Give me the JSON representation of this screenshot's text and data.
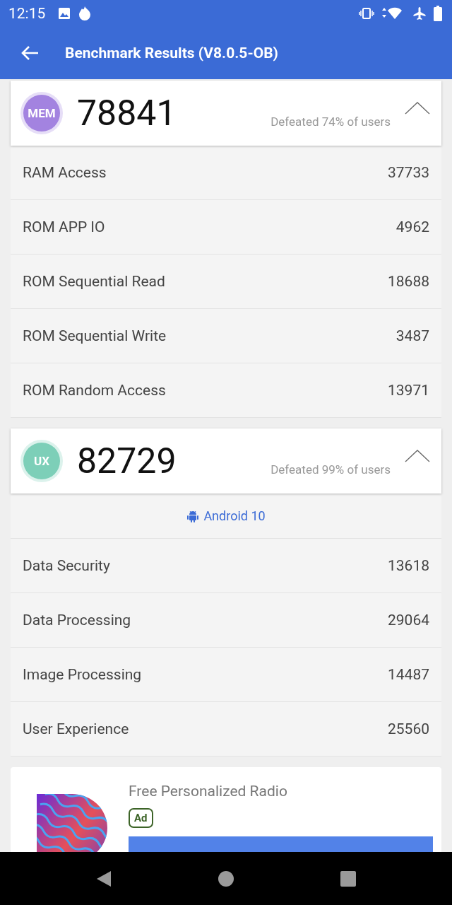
{
  "status_bar": {
    "time": "12:15"
  },
  "app_bar": {
    "title": "Benchmark Results (V8.0.5-OB)"
  },
  "sections": [
    {
      "badge": "MEM",
      "color": "#a383e0",
      "score": "78841",
      "defeated": "Defeated 74% of users",
      "expanded": true,
      "rows": [
        {
          "label": "RAM Access",
          "value": "37733"
        },
        {
          "label": "ROM APP IO",
          "value": "4962"
        },
        {
          "label": "ROM Sequential Read",
          "value": "18688"
        },
        {
          "label": "ROM Sequential Write",
          "value": "3487"
        },
        {
          "label": "ROM Random Access",
          "value": "13971"
        }
      ]
    },
    {
      "badge": "UX",
      "color": "#7dcfb8",
      "score": "82729",
      "defeated": "Defeated 99% of users",
      "expanded": true,
      "note": "Android 10",
      "rows": [
        {
          "label": "Data Security",
          "value": "13618"
        },
        {
          "label": "Data Processing",
          "value": "29064"
        },
        {
          "label": "Image Processing",
          "value": "14487"
        },
        {
          "label": "User Experience",
          "value": "25560"
        }
      ]
    }
  ],
  "ad": {
    "title": "Free Personalized Radio",
    "tag": "Ad"
  }
}
